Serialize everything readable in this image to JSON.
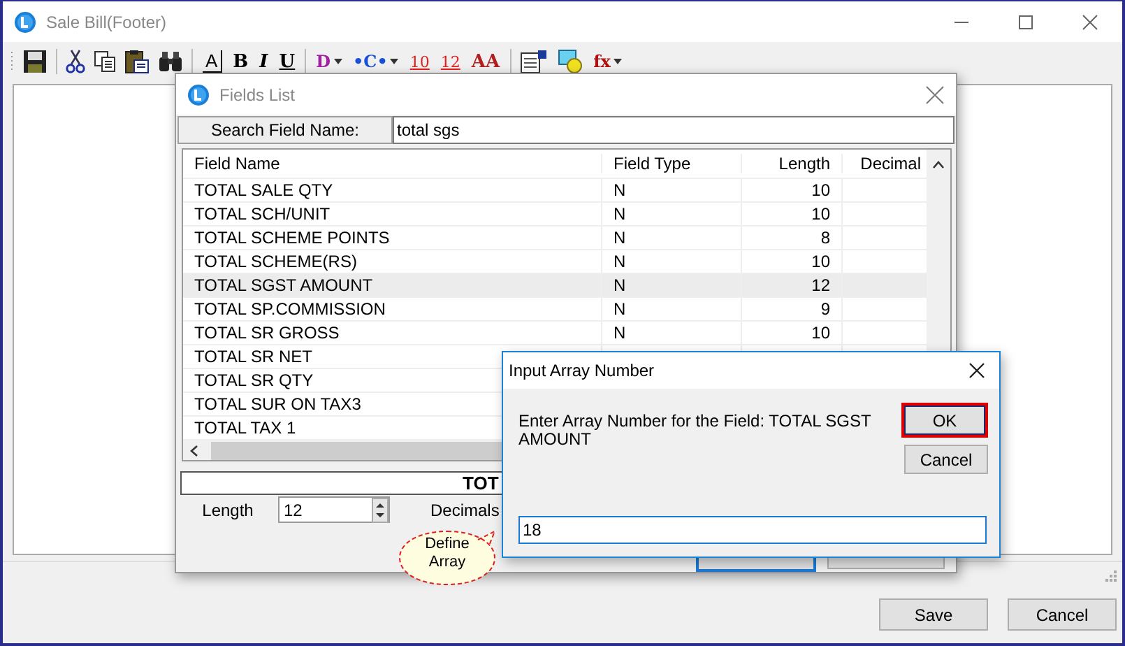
{
  "window": {
    "title": "Sale Bill(Footer)"
  },
  "toolbar": [
    {
      "kind": "save"
    },
    {
      "kind": "sep"
    },
    {
      "kind": "cut"
    },
    {
      "kind": "copy"
    },
    {
      "kind": "paste"
    },
    {
      "kind": "find"
    },
    {
      "kind": "sep"
    },
    {
      "kind": "boxed",
      "label": "A"
    },
    {
      "kind": "bold",
      "label": "B"
    },
    {
      "kind": "italic",
      "label": "I"
    },
    {
      "kind": "underline",
      "label": "U"
    },
    {
      "kind": "sep"
    },
    {
      "kind": "menu",
      "label": "D",
      "color": "#a020a0"
    },
    {
      "kind": "menu",
      "label": "•C•",
      "color": "#1a4fd8"
    },
    {
      "kind": "red",
      "label": "10"
    },
    {
      "kind": "red",
      "label": "12"
    },
    {
      "kind": "duo",
      "label": "AA"
    },
    {
      "kind": "sep"
    },
    {
      "kind": "props"
    },
    {
      "kind": "shapes"
    },
    {
      "kind": "menu",
      "label": "fx",
      "color": "#b01010"
    }
  ],
  "fields_list": {
    "title": "Fields List",
    "search_label": "Search Field Name:",
    "search_value": "total sgs",
    "columns": [
      "Field Name",
      "Field Type",
      "Length",
      "Decimal"
    ],
    "rows": [
      {
        "name": "TOTAL SALE QTY",
        "type": "N",
        "length": "10",
        "selected": false
      },
      {
        "name": "TOTAL SCH/UNIT",
        "type": "N",
        "length": "10",
        "selected": false
      },
      {
        "name": "TOTAL SCHEME POINTS",
        "type": "N",
        "length": "8",
        "selected": false
      },
      {
        "name": "TOTAL SCHEME(RS)",
        "type": "N",
        "length": "10",
        "selected": false
      },
      {
        "name": "TOTAL SGST AMOUNT",
        "type": "N",
        "length": "12",
        "selected": true
      },
      {
        "name": "TOTAL SP.COMMISSION",
        "type": "N",
        "length": "9",
        "selected": false
      },
      {
        "name": "TOTAL SR GROSS",
        "type": "N",
        "length": "10",
        "selected": false
      },
      {
        "name": "TOTAL SR NET",
        "selected": false
      },
      {
        "name": "TOTAL SR QTY",
        "selected": false
      },
      {
        "name": "TOTAL SUR ON TAX3",
        "selected": false
      },
      {
        "name": "TOTAL TAX 1",
        "selected": false
      }
    ],
    "field_caption": "TOT",
    "length_label": "Length",
    "length_value": "12",
    "decimals_label": "Decimals",
    "callout": "Define Array"
  },
  "input_dialog": {
    "title": "Input Array Number",
    "message": "Enter Array Number for the Field: TOTAL SGST AMOUNT",
    "value": "18",
    "buttons": [
      {
        "label": "OK",
        "default": true
      },
      {
        "label": "Cancel",
        "default": false
      }
    ]
  },
  "buttons": [
    "Save",
    "Cancel"
  ]
}
